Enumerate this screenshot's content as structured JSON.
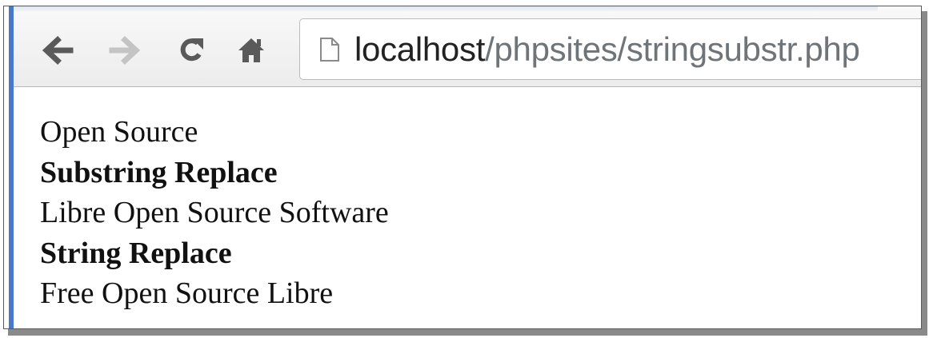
{
  "browser": {
    "url_host": "localhost",
    "url_path": "/phpsites/stringsubstr.php",
    "nav_icons": [
      "back-arrow-icon",
      "forward-arrow-icon",
      "reload-icon",
      "home-icon",
      "page-icon"
    ]
  },
  "content": {
    "line1": "Open Source",
    "heading1": "Substring Replace",
    "line2": "Libre Open Source Software",
    "heading2": "String Replace",
    "line3": "Free Open Source Libre"
  },
  "colors": {
    "accent_edge": "#4a78c8",
    "url_path": "#6f7478"
  }
}
